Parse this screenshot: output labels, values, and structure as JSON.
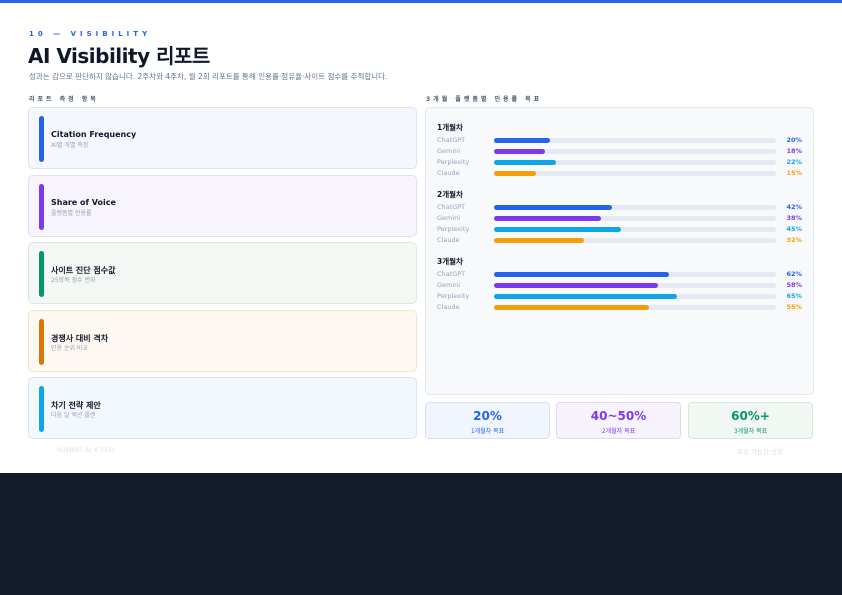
{
  "header": {
    "eyebrow": "10 — VISIBILITY",
    "title": "AI Visibility 리포트",
    "subtitle": "성과는 감으로 판단하지 않습니다. 2주차와 4주차, 월 2회 리포트를 통해 인용률·점유율·사이트 점수를 추적합니다."
  },
  "left": {
    "section_label": "리포트 측정 항목",
    "items": [
      {
        "title": "Citation Frequency",
        "sub": "AI별 개별 측정",
        "accent": "#2563eb",
        "bg": "#f4f7fd",
        "border": "#dbe4f5"
      },
      {
        "title": "Share of Voice",
        "sub": "플랫폼별 인용률",
        "accent": "#7c3aed",
        "bg": "#f7f4fd",
        "border": "#e4dcf5"
      },
      {
        "title": "사이트 진단 점수값",
        "sub": "25항목 점수 변화",
        "accent": "#059669",
        "bg": "#f3f8f5",
        "border": "#d8eadf"
      },
      {
        "title": "경쟁사 대비 격차",
        "sub": "인용 순위 비교",
        "accent": "#d97706",
        "bg": "#fdf8f1",
        "border": "#f1e4cf"
      },
      {
        "title": "차기 전략 제안",
        "sub": "다음 달 액션 플랜",
        "accent": "#0ea5e9",
        "bg": "#f2f8fc",
        "border": "#d6e8f3"
      }
    ]
  },
  "right": {
    "section_label": "3개월 플랫폼별 인용률 목표",
    "platforms": [
      {
        "name": "ChatGPT",
        "color": "#2563eb"
      },
      {
        "name": "Gemini",
        "color": "#7c3aed"
      },
      {
        "name": "Perplexity",
        "color": "#0ea5e9"
      },
      {
        "name": "Claude",
        "color": "#f59e0b"
      }
    ]
  },
  "chart_data": {
    "type": "bar",
    "orientation": "horizontal",
    "groups": [
      {
        "name": "1개월차",
        "values": [
          20,
          18,
          22,
          15
        ],
        "labels": [
          "20%",
          "18%",
          "22%",
          "15%"
        ]
      },
      {
        "name": "2개월차",
        "values": [
          42,
          38,
          45,
          32
        ],
        "labels": [
          "42%",
          "38%",
          "45%",
          "32%"
        ]
      },
      {
        "name": "3개월차",
        "values": [
          62,
          58,
          65,
          55
        ],
        "labels": [
          "62%",
          "58%",
          "65%",
          "55%"
        ]
      }
    ],
    "categories": [
      "ChatGPT",
      "Gemini",
      "Perplexity",
      "Claude"
    ],
    "xlim": [
      0,
      100
    ]
  },
  "targets": [
    {
      "value": "20%",
      "label": "1개월차 목표",
      "color": "#2563eb",
      "bg": "#f1f5fd",
      "border": "#d5e0f5"
    },
    {
      "value": "40~50%",
      "label": "2개월차 목표",
      "color": "#7c3aed",
      "bg": "#f7f3fd",
      "border": "#e2d8f5"
    },
    {
      "value": "60%+",
      "label": "3개월차 목표",
      "color": "#059669",
      "bg": "#f1f8f4",
      "border": "#d3e9dc"
    }
  ],
  "footer": {
    "left": "SUMMIT AI X GEO",
    "right": "측정 가능한 성장"
  }
}
